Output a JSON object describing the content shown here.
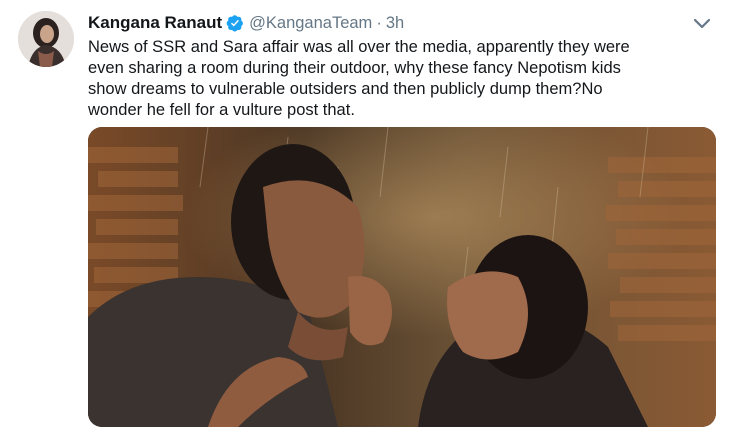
{
  "tweet": {
    "author_name": "Kangana Ranaut",
    "handle": "@KanganaTeam",
    "separator": "·",
    "time": "3h",
    "text_lines": [
      "News of SSR and Sara affair was all over the media, apparently they were",
      "even sharing a room during their outdoor, why these fancy Nepotism kids",
      "show dreams to vulnerable outsiders and then publicly dump them?No",
      "wonder he fell for a vulture post that."
    ],
    "icons": {
      "verified": "verified-badge-icon",
      "menu": "chevron-down-icon"
    }
  },
  "colors": {
    "verified": "#1da1f2",
    "handle": "#657786",
    "text": "#14171a",
    "caret": "#657786"
  }
}
